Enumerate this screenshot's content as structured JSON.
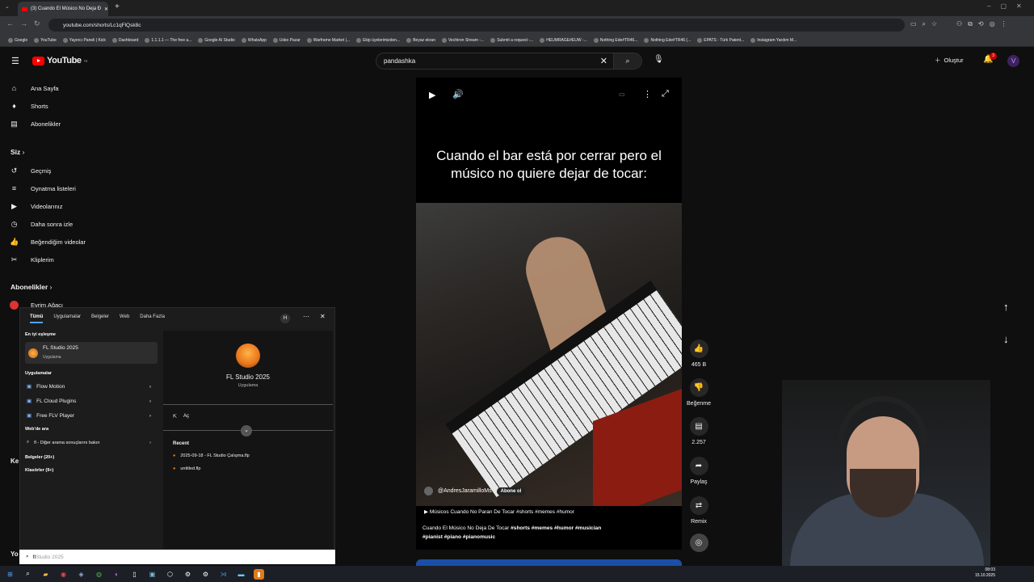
{
  "browser": {
    "tab_title": "(3) Cuando El Músico No Deja Đ",
    "url": "youtube.com/shorts/Lc1qFlQsk8c",
    "bookmarks": [
      "Google",
      "YouTube",
      "Yayıncı Paneli | Kick",
      "Dashboard",
      "1.1.1.1 — The free a...",
      "Google AI Studio",
      "WhatsApp",
      "Usko Pazar",
      "Warframe Market |...",
      "Ekip üyelerimizden...",
      "Beyaz ekran",
      "Vechiron Stream -...",
      "Submit a request -...",
      "HEUMRAGE#EUW -...",
      "Nothing Ede#TR46...",
      "Nothing Ede#TR46 (...",
      "EPATS - Türk Patent...",
      "Instagram Yardım M..."
    ]
  },
  "youtube": {
    "logo": "YouTube",
    "logo_region": "TR",
    "search_value": "pandashka",
    "create_label": "Oluştur",
    "notif_count": "3",
    "avatar_letter": "V"
  },
  "sidebar": {
    "top": [
      {
        "label": "Ana Sayfa",
        "icon": "home-icon"
      },
      {
        "label": "Shorts",
        "icon": "shorts-icon"
      },
      {
        "label": "Abonelikler",
        "icon": "subscriptions-icon"
      }
    ],
    "you_header": "Siz",
    "you_items": [
      {
        "label": "Geçmiş",
        "icon": "history-icon"
      },
      {
        "label": "Oynatma listeleri",
        "icon": "playlists-icon"
      },
      {
        "label": "Videolarınız",
        "icon": "your-videos-icon"
      },
      {
        "label": "Daha sonra izle",
        "icon": "watch-later-icon"
      },
      {
        "label": "Beğendiğim videolar",
        "icon": "liked-icon"
      },
      {
        "label": "Kliplerim",
        "icon": "clips-icon"
      }
    ],
    "subs_header": "Abonelikler",
    "sub_first": "Evrim Ağacı",
    "partial_letters": [
      "Ke",
      "Yo"
    ]
  },
  "short": {
    "caption": "Cuando el bar está por cerrar pero el músico no quiere dejar de tocar:",
    "channel": "@AndresJaramilloMs",
    "subscribe": "Abone ol",
    "suggestion": "Músicos Cuando No Paran De Tocar #shorts #memes #humor",
    "title_plain": "Cuando El Músico No Deja De Tocar",
    "tags_line1": "#shorts #memes #humor #musician",
    "tags_line2": "#pianist #piano #pianomusic"
  },
  "actions": {
    "like_count": "465 B",
    "dislike_label": "Beğenme",
    "comment_count": "2.257",
    "share_label": "Paylaş",
    "remix_label": "Remix"
  },
  "startmenu": {
    "tabs": [
      "Tümü",
      "Uygulamalar",
      "Belgeler",
      "Web",
      "Daha Fazla"
    ],
    "user_initial": "H",
    "best_match_header": "En iyi eşleşme",
    "best_match": {
      "name": "FL Studio 2025",
      "type": "Uygulama"
    },
    "apps_header": "Uygulamalar",
    "apps": [
      "Flow Motion",
      "FL Cloud Plugins",
      "Free FLV Player"
    ],
    "web_header": "Web'de ara",
    "web_item": "fl - Diğer arama sonuçlarını bakın",
    "docs_header": "Belgeler (20+)",
    "folders_header": "Klasörler (9+)",
    "preview": {
      "name": "FL Studio 2025",
      "type": "Uygulama",
      "open": "Aç",
      "recent_header": "Recent"
    },
    "recent": [
      "2025-09-18 - FL Studio Çalışma.flp",
      "untitled.flp"
    ],
    "search_typed": "fl",
    "search_hint": "Studio 2025"
  },
  "taskbar": {
    "time": "08:03",
    "date": "15.10.2025"
  }
}
